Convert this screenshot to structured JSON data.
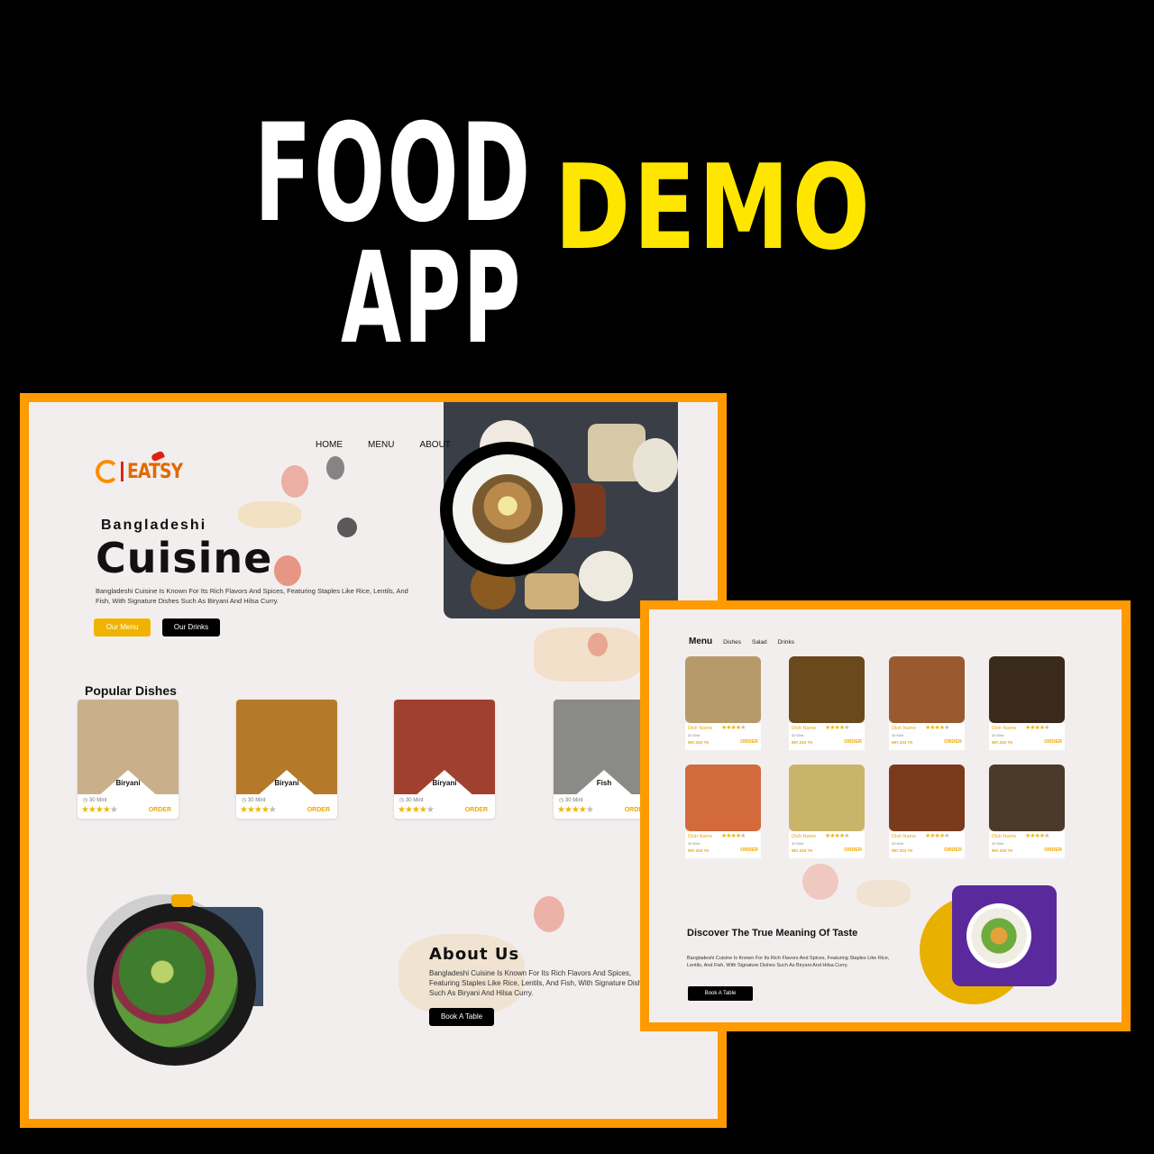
{
  "headline": {
    "food": "FOOD",
    "app": "APP",
    "demo": "DEMO"
  },
  "home": {
    "nav": [
      "HOME",
      "MENU",
      "ABOUT"
    ],
    "logo_text": "EATSY",
    "hero_sub": "Bangladeshi",
    "hero_title": "Cuisine",
    "hero_desc": "Bangladeshi Cuisine Is Known For Its Rich Flavors And Spices, Featuring Staples Like Rice, Lentils, And Fish, With Signature Dishes Such As Biryani And Hilsa Curry.",
    "btn_menu": "Our Menu",
    "btn_drinks": "Our Drinks",
    "popular_title": "Popular Dishes",
    "popular": [
      {
        "name": "Biryani",
        "time": "30 Mint",
        "stars": 4,
        "order": "ORDER",
        "color": "#c9b08a"
      },
      {
        "name": "Biryani",
        "time": "30 Mint",
        "stars": 4,
        "order": "ORDER",
        "color": "#b47a2a"
      },
      {
        "name": "Biryani",
        "time": "30 Mint",
        "stars": 4,
        "order": "ORDER",
        "color": "#a0402e"
      },
      {
        "name": "Fish",
        "time": "30 Mint",
        "stars": 4,
        "order": "ORDER",
        "color": "#8a8a86"
      }
    ],
    "about_title": "About Us",
    "about_desc": "Bangladeshi Cuisine Is Known For Its Rich Flavors And Spices, Featuring Staples Like Rice, Lentils, And Fish, With Signature Dishes Such As Biryani And Hilsa Curry.",
    "btn_book": "Book A Table"
  },
  "menu": {
    "tab_active": "Menu",
    "tabs": [
      "Dishes",
      "Salad",
      "Drinks"
    ],
    "items": [
      {
        "name": "Dish Name",
        "time": "30 Mint",
        "price": "997.253 TK",
        "order": "ORDER",
        "color": "#b69a6a"
      },
      {
        "name": "Dish Name",
        "time": "30 Mint",
        "price": "997.253 TK",
        "order": "ORDER",
        "color": "#6a4a1c"
      },
      {
        "name": "Dish Name",
        "time": "30 Mint",
        "price": "997.253 TK",
        "order": "ORDER",
        "color": "#9a5a30"
      },
      {
        "name": "Dish Name",
        "time": "30 Mint",
        "price": "997.253 TK",
        "order": "ORDER",
        "color": "#3a2a1c"
      },
      {
        "name": "Dish Name",
        "time": "30 Mint",
        "price": "997.253 TK",
        "order": "ORDER",
        "color": "#d26a3e"
      },
      {
        "name": "Dish Name",
        "time": "30 Mint",
        "price": "997.253 TK",
        "order": "ORDER",
        "color": "#c9b46a"
      },
      {
        "name": "Dish Name",
        "time": "30 Mint",
        "price": "997.253 TK",
        "order": "ORDER",
        "color": "#7a3a1c"
      },
      {
        "name": "Dish Name",
        "time": "30 Mint",
        "price": "997.253 TK",
        "order": "ORDER",
        "color": "#4a3a2a"
      }
    ],
    "disc_title": "Discover The True Meaning Of Taste",
    "disc_desc": "Bangladeshi Cuisine Is Known For Its Rich Flavors And Spices, Featuring Staples Like Rice, Lentils, And Fish, With Signature Dishes Such As Biryani And Hilsa Curry.",
    "btn_book": "Book A Table"
  },
  "colors": {
    "accent": "#ff9a00",
    "yellow": "#ffe600",
    "gold": "#f0b400"
  }
}
